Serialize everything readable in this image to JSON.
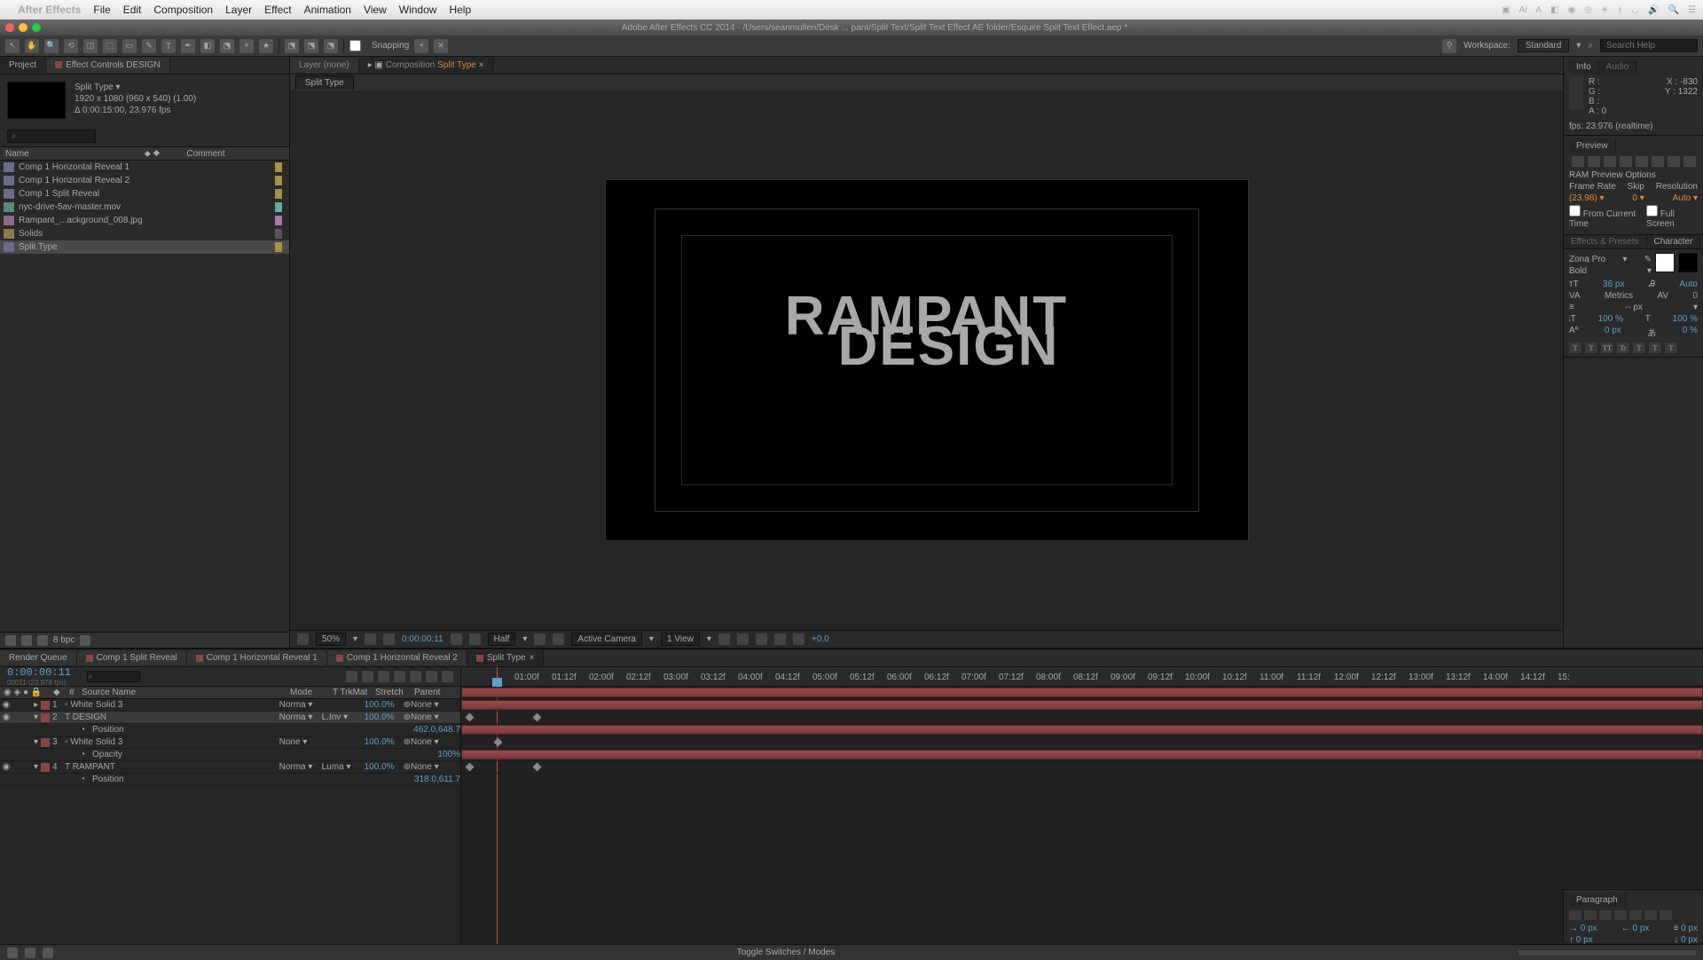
{
  "mac_menu": {
    "app": "After Effects",
    "items": [
      "File",
      "Edit",
      "Composition",
      "Layer",
      "Effect",
      "Animation",
      "View",
      "Window",
      "Help"
    ],
    "right_icons": [
      "⚙",
      "Ai",
      "A",
      "☰",
      "◎",
      "◉",
      "✶",
      "⌁",
      "⚲",
      "🔍",
      "☰"
    ]
  },
  "window_title": "Adobe After Effects CC 2014 - /Users/seanmullen/Desk ... pant/Split Text/Split Text Effect AE folder/Esquire Split Text Effect.aep *",
  "toolbar": {
    "tools": [
      "↖",
      "✋",
      "🔍",
      "⟲",
      "◫",
      "⬚",
      "✎",
      "T",
      "✒",
      "◧",
      "⬔",
      "⌖",
      "★"
    ],
    "snapping": "Snapping",
    "workspace_label": "Workspace:",
    "workspace_value": "Standard",
    "search_placeholder": "Search Help"
  },
  "project": {
    "tabs": {
      "project": "Project",
      "efc": "Effect Controls DESIGN"
    },
    "comp_name": "Split Type ▾",
    "meta_line1": "1920 x 1080 (960 x 540) (1.00)",
    "meta_line2": "Δ 0:00:15:00, 23.976 fps",
    "search_placeholder": "⌕",
    "cols": {
      "name": "Name",
      "comment": "Comment"
    },
    "items": [
      {
        "name": "Comp 1 Horizontal Reveal 1",
        "type": "comp"
      },
      {
        "name": "Comp 1 Horizontal Reveal 2",
        "type": "comp"
      },
      {
        "name": "Comp 1 Split Reveal",
        "type": "comp"
      },
      {
        "name": "nyc-drive-5av-master.mov",
        "type": "video"
      },
      {
        "name": "Rampant_...ackground_008.jpg",
        "type": "image"
      },
      {
        "name": "Solids",
        "type": "folder"
      },
      {
        "name": "Split Type",
        "type": "comp",
        "selected": true
      }
    ],
    "footer_bpc": "8 bpc"
  },
  "comp_panel": {
    "layer_tab": "Layer (none)",
    "comp_tab_label": "Composition",
    "comp_tab_name": "Split Type",
    "sub_tab": "Split Type",
    "text_line1": "RAMPANT",
    "text_line2": "DESIGN"
  },
  "viewer_footer": {
    "zoom": "50%",
    "timecode": "0:00:00:11",
    "res": "Half",
    "camera": "Active Camera",
    "views": "1 View",
    "exposure": "+0.0"
  },
  "info_panel": {
    "tabs": [
      "Info",
      "Audio"
    ],
    "r": "R :",
    "g": "G :",
    "b": "B :",
    "a": "A : 0",
    "x": "X : -830",
    "y": "Y : 1322",
    "fps": "fps: 23.976 (realtime)"
  },
  "preview_panel": {
    "title": "Preview",
    "ram": "RAM Preview Options",
    "frame_rate_l": "Frame Rate",
    "skip_l": "Skip",
    "res_l": "Resolution",
    "frame_rate_v": "(23.98) ▾",
    "skip_v": "0 ▾",
    "res_v": "Auto ▾",
    "from_l": "From Current Time",
    "full_l": "Full Screen"
  },
  "efp_panel": {
    "tabs": [
      "Effects & Presets",
      "Character"
    ]
  },
  "char_panel": {
    "font": "Zona Pro",
    "style": "Bold",
    "size": "36 px",
    "leading": "Auto",
    "kerning": "Metrics",
    "tracking": "0",
    "vscale": "-- px",
    "hscale": "100 %",
    "hscale2": "100 %",
    "baseline": "0 px",
    "tsume": "0 %",
    "btns": [
      "T",
      "T",
      "TT",
      "Tr",
      "T",
      "T",
      "T"
    ]
  },
  "timeline": {
    "tabs": [
      "Render Queue",
      "Comp 1 Split Reveal",
      "Comp 1 Horizontal Reveal 1",
      "Comp 1 Horizontal Reveal 2",
      "Split Type"
    ],
    "active_tab": 4,
    "timecode": "0:00:00:11",
    "fps_sub": "00011 (23.976 fps)",
    "cols": {
      "num": "#",
      "source": "Source Name",
      "mode": "Mode",
      "trk": "T TrkMat",
      "stretch": "Stretch",
      "parent": "Parent"
    },
    "layers": [
      {
        "n": 1,
        "name": "White Solid 3",
        "mode": "Norma ▾",
        "trk": "",
        "stretch": "100.0%",
        "parent": "None ▾"
      },
      {
        "n": 2,
        "name": "DESIGN",
        "mode": "Norma ▾",
        "trk": "L.Inv ▾",
        "stretch": "100.0%",
        "parent": "None ▾",
        "selected": true,
        "prop": "Position",
        "propval": "462.0,648.7"
      },
      {
        "n": 3,
        "name": "White Solid 3",
        "mode": "None ▾",
        "trk": "",
        "stretch": "100.0%",
        "parent": "None ▾",
        "prop": "Opacity",
        "propval": "100%"
      },
      {
        "n": 4,
        "name": "RAMPANT",
        "mode": "Norma ▾",
        "trk": "Luma ▾",
        "stretch": "100.0%",
        "parent": "None ▾",
        "prop": "Position",
        "propval": "318.0,611.7"
      }
    ],
    "ruler": [
      "01:00f",
      "01:12f",
      "02:00f",
      "02:12f",
      "03:00f",
      "03:12f",
      "04:00f",
      "04:12f",
      "05:00f",
      "05:12f",
      "06:00f",
      "06:12f",
      "07:00f",
      "07:12f",
      "08:00f",
      "08:12f",
      "09:00f",
      "09:12f",
      "10:00f",
      "10:12f",
      "11:00f",
      "11:12f",
      "12:00f",
      "12:12f",
      "13:00f",
      "13:12f",
      "14:00f",
      "14:12f",
      "15:"
    ],
    "footer_toggle": "Toggle Switches / Modes"
  },
  "paragraph": {
    "title": "Paragraph",
    "indent": "0 px",
    "indent_r": "0 px",
    "space": "0 px",
    "indent_t": "0 px",
    "space_b": "0 px"
  }
}
